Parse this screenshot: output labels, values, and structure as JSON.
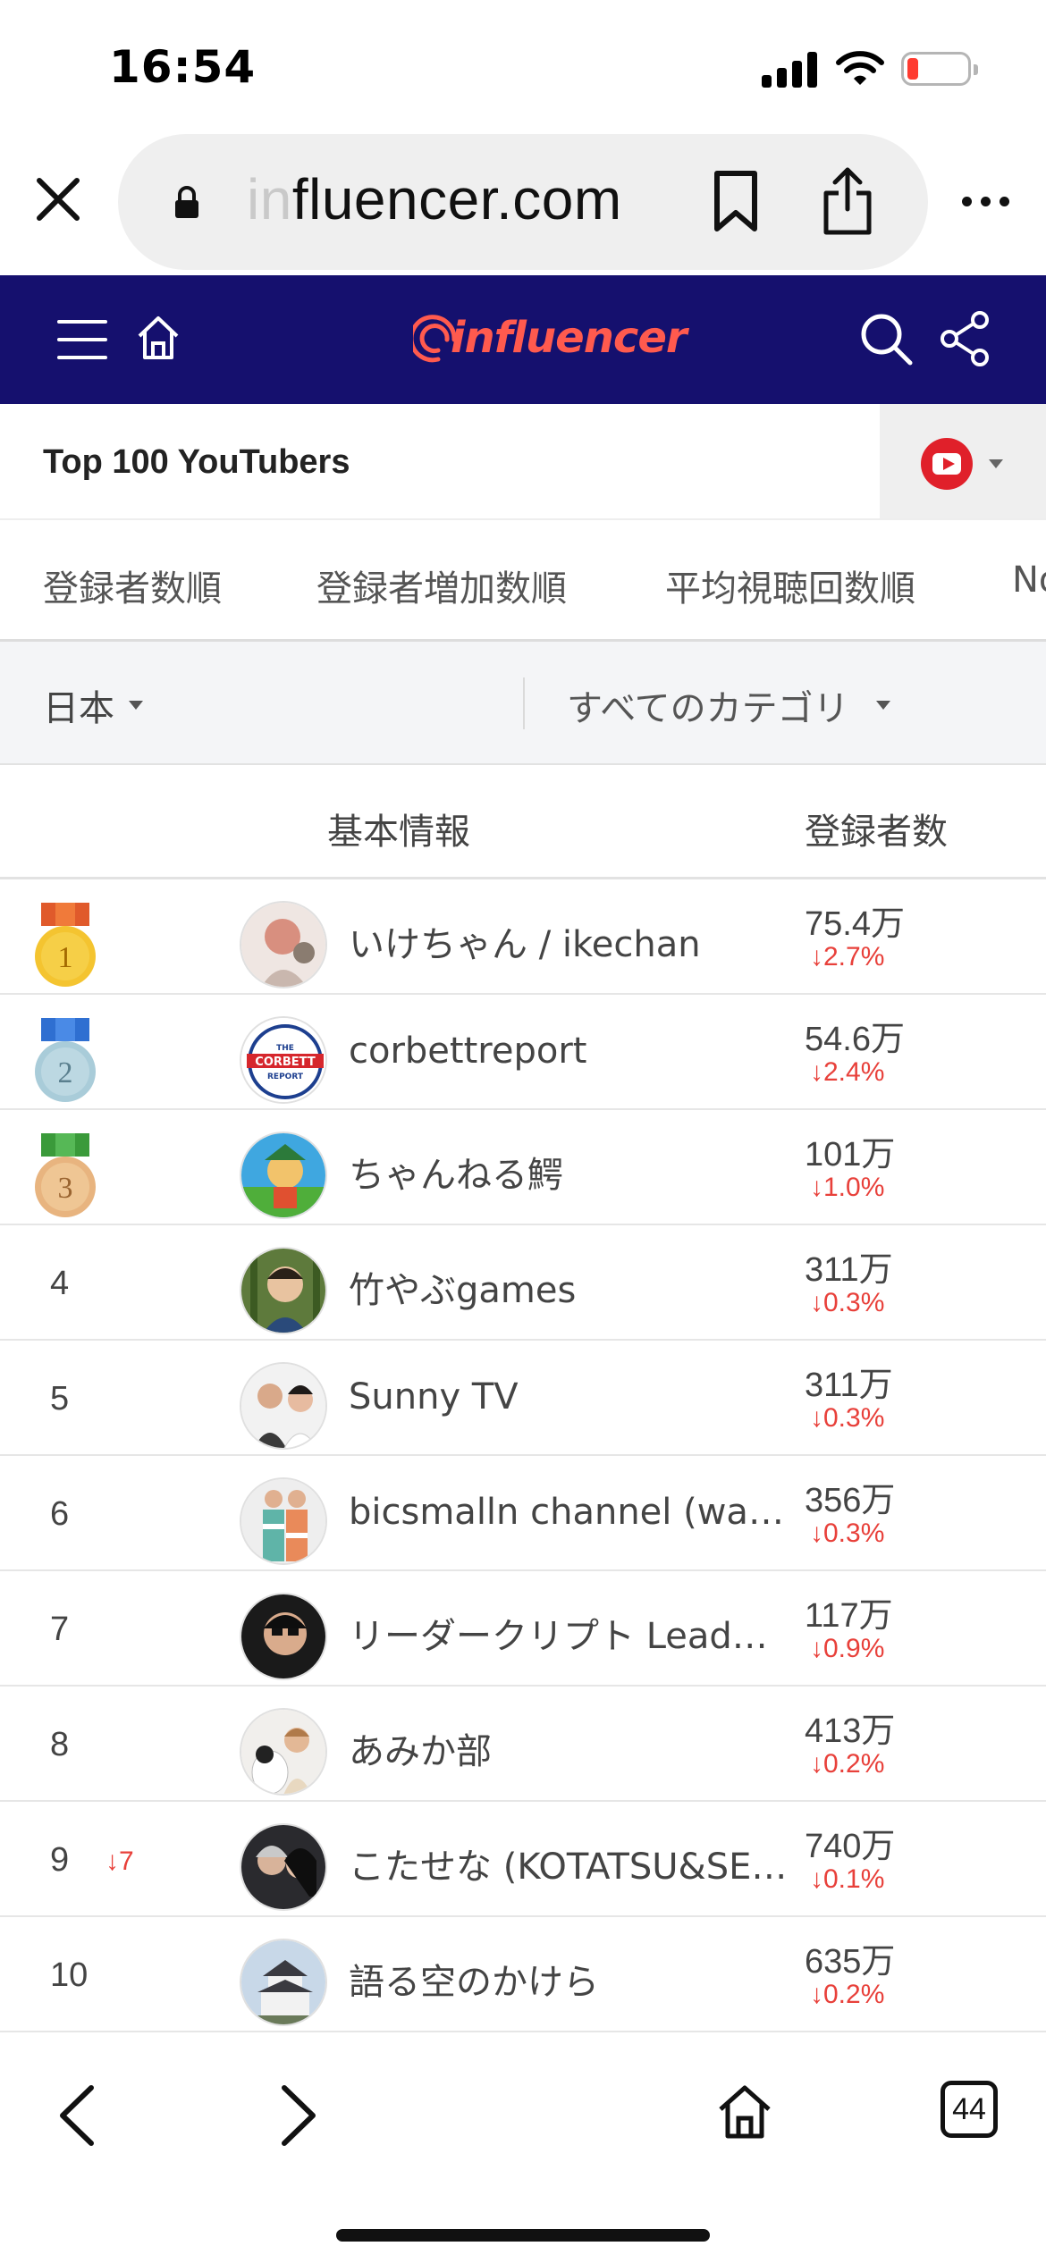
{
  "status_bar": {
    "time": "16:54"
  },
  "browser": {
    "url_faded": "in",
    "url_main": "fluencer.com",
    "tabs_count": "44"
  },
  "site": {
    "logo_text": "influencer",
    "brand_color": "#15106e",
    "accent_color": "#ff5a4e"
  },
  "page": {
    "title": "Top 100 YouTubers",
    "platform_icon": "youtube-icon"
  },
  "sort_tabs": [
    "登録者数順",
    "登録者増加数順",
    "平均視聴回数順",
    "No"
  ],
  "filters": {
    "country": "日本",
    "category": "すべてのカテゴリ"
  },
  "table": {
    "col_info": "基本情報",
    "col_subscribers": "登録者数",
    "rows": [
      {
        "rank": "1",
        "change": "",
        "name": "いけちゃん / ikechan",
        "subscribers": "75.4万",
        "delta": "2.7%"
      },
      {
        "rank": "2",
        "change": "",
        "name": "corbettreport",
        "subscribers": "54.6万",
        "delta": "2.4%"
      },
      {
        "rank": "3",
        "change": "",
        "name": "ちゃんねる鰐",
        "subscribers": "101万",
        "delta": "1.0%"
      },
      {
        "rank": "4",
        "change": "",
        "name": "竹やぶgames",
        "subscribers": "311万",
        "delta": "0.3%"
      },
      {
        "rank": "5",
        "change": "",
        "name": "Sunny TV",
        "subscribers": "311万",
        "delta": "0.3%"
      },
      {
        "rank": "6",
        "change": "",
        "name": "bicsmalln channel (wan…",
        "subscribers": "356万",
        "delta": "0.3%"
      },
      {
        "rank": "7",
        "change": "",
        "name": "リーダークリプト Lead…",
        "subscribers": "117万",
        "delta": "0.9%"
      },
      {
        "rank": "8",
        "change": "",
        "name": "あみか部",
        "subscribers": "413万",
        "delta": "0.2%"
      },
      {
        "rank": "9",
        "change": "7",
        "name": "こたせな (KOTATSU&SE…",
        "subscribers": "740万",
        "delta": "0.1%"
      },
      {
        "rank": "10",
        "change": "",
        "name": "語る空のかけら",
        "subscribers": "635万",
        "delta": "0.2%"
      }
    ]
  },
  "avatar_logo": {
    "line1": "THE",
    "line2": "CORBETT",
    "line3": "REPORT"
  }
}
